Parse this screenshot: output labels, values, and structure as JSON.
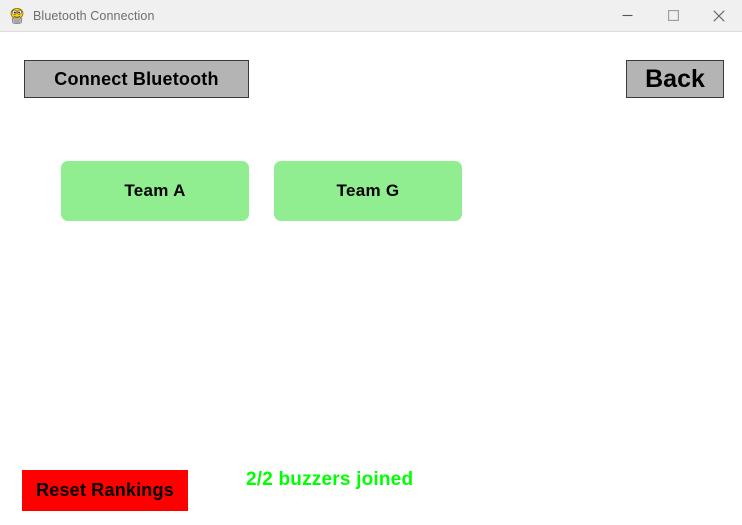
{
  "window": {
    "title": "Bluetooth Connection",
    "icon": "app-mascot-icon",
    "controls": {
      "minimize": "minimize-icon",
      "maximize": "maximize-icon",
      "close": "close-icon"
    }
  },
  "toolbar": {
    "connect_label": "Connect Bluetooth",
    "back_label": "Back"
  },
  "teams": [
    {
      "label": "Team A"
    },
    {
      "label": "Team G"
    }
  ],
  "footer": {
    "reset_label": "Reset Rankings",
    "status_text": "2/2 buzzers joined",
    "buzzers_joined": 2,
    "buzzers_total": 2
  },
  "colors": {
    "titlebar_bg": "#f0f0f0",
    "titlebar_text": "#6e6e6e",
    "client_bg": "#ffffff",
    "gray_button_bg": "#b4b4b4",
    "gray_button_border": "#3a3a3a",
    "team_button_bg": "#90ee90",
    "reset_button_bg": "#ff0000",
    "status_text": "#00ff00",
    "button_text": "#000000"
  }
}
